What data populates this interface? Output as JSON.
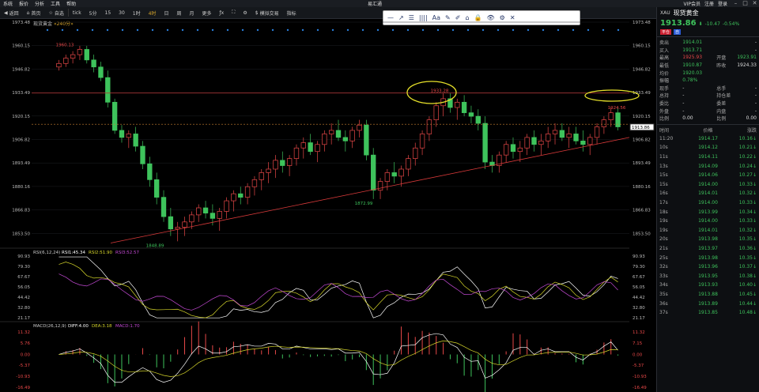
{
  "menubar": {
    "items": [
      "系统",
      "报价",
      "分析",
      "工具",
      "帮助"
    ],
    "app_title": "易汇通",
    "right_items": [
      "VIP会员",
      "注册",
      "登录"
    ]
  },
  "toolbar": {
    "buttons": [
      "返回",
      "首页",
      "自选",
      "tick",
      "5分",
      "15",
      "30",
      "1时",
      "4时",
      "日",
      "周",
      "月",
      "更多",
      "模拟交易",
      "指标"
    ]
  },
  "drawing_toolbar": {
    "tools": [
      "—",
      "↗",
      "☰",
      "||||",
      "Aa",
      "✎",
      "✐",
      "⌂",
      "🔒",
      "👁",
      "⚙",
      "✕"
    ]
  },
  "chart": {
    "title": "现货黄金",
    "period": "240分",
    "left_axis": [
      "1973.48",
      "1960.15",
      "1946.82",
      "1933.49",
      "1920.15",
      "1906.82",
      "1893.49",
      "1880.16",
      "1866.83",
      "1853.50"
    ],
    "right_axis": [
      "1973.48",
      "1960.15",
      "1946.82",
      "1933.49",
      "1920.15",
      "1906.82",
      "1893.49",
      "1880.16",
      "1866.83",
      "1853.50"
    ],
    "current_price_tag": "1913.86",
    "annotations": [
      "1960.13",
      "1933.28",
      "1924.56",
      "1872.99",
      "1848.89"
    ],
    "candles": [
      [
        1948,
        1952,
        1946,
        1950
      ],
      [
        1950,
        1955,
        1948,
        1953
      ],
      [
        1953,
        1957,
        1950,
        1955
      ],
      [
        1955,
        1960,
        1952,
        1958
      ],
      [
        1958,
        1960,
        1950,
        1952
      ],
      [
        1952,
        1955,
        1945,
        1948
      ],
      [
        1948,
        1951,
        1940,
        1942
      ],
      [
        1942,
        1946,
        1925,
        1928
      ],
      [
        1928,
        1930,
        1910,
        1912
      ],
      [
        1912,
        1915,
        1905,
        1908
      ],
      [
        1908,
        1912,
        1902,
        1910
      ],
      [
        1910,
        1914,
        1900,
        1903
      ],
      [
        1903,
        1906,
        1890,
        1893
      ],
      [
        1893,
        1897,
        1880,
        1884
      ],
      [
        1884,
        1888,
        1870,
        1874
      ],
      [
        1874,
        1878,
        1860,
        1863
      ],
      [
        1863,
        1868,
        1852,
        1856
      ],
      [
        1856,
        1860,
        1849,
        1857
      ],
      [
        1857,
        1863,
        1852,
        1860
      ],
      [
        1860,
        1866,
        1856,
        1864
      ],
      [
        1864,
        1870,
        1860,
        1868
      ],
      [
        1868,
        1872,
        1862,
        1865
      ],
      [
        1865,
        1870,
        1858,
        1862
      ],
      [
        1862,
        1868,
        1855,
        1866
      ],
      [
        1866,
        1874,
        1862,
        1872
      ],
      [
        1872,
        1878,
        1866,
        1876
      ],
      [
        1876,
        1880,
        1870,
        1874
      ],
      [
        1874,
        1882,
        1870,
        1880
      ],
      [
        1880,
        1886,
        1875,
        1884
      ],
      [
        1884,
        1890,
        1878,
        1888
      ],
      [
        1888,
        1894,
        1882,
        1890
      ],
      [
        1890,
        1898,
        1885,
        1895
      ],
      [
        1895,
        1900,
        1888,
        1892
      ],
      [
        1892,
        1898,
        1886,
        1896
      ],
      [
        1896,
        1904,
        1892,
        1902
      ],
      [
        1902,
        1908,
        1896,
        1905
      ],
      [
        1905,
        1910,
        1898,
        1900
      ],
      [
        1900,
        1906,
        1894,
        1904
      ],
      [
        1904,
        1912,
        1900,
        1910
      ],
      [
        1910,
        1916,
        1904,
        1912
      ],
      [
        1912,
        1918,
        1906,
        1908
      ],
      [
        1908,
        1912,
        1900,
        1906
      ],
      [
        1906,
        1914,
        1902,
        1912
      ],
      [
        1912,
        1918,
        1908,
        1915
      ],
      [
        1915,
        1918,
        1895,
        1898
      ],
      [
        1898,
        1902,
        1873,
        1878
      ],
      [
        1878,
        1885,
        1873,
        1883
      ],
      [
        1883,
        1890,
        1878,
        1888
      ],
      [
        1888,
        1894,
        1882,
        1886
      ],
      [
        1886,
        1892,
        1880,
        1890
      ],
      [
        1890,
        1898,
        1886,
        1896
      ],
      [
        1896,
        1905,
        1892,
        1902
      ],
      [
        1902,
        1912,
        1898,
        1910
      ],
      [
        1910,
        1920,
        1906,
        1918
      ],
      [
        1918,
        1928,
        1914,
        1926
      ],
      [
        1926,
        1933,
        1920,
        1930
      ],
      [
        1930,
        1933,
        1922,
        1925
      ],
      [
        1925,
        1930,
        1918,
        1928
      ],
      [
        1928,
        1932,
        1920,
        1922
      ],
      [
        1922,
        1926,
        1916,
        1920
      ],
      [
        1920,
        1924,
        1912,
        1916
      ],
      [
        1916,
        1920,
        1890,
        1894
      ],
      [
        1894,
        1898,
        1888,
        1892
      ],
      [
        1892,
        1900,
        1888,
        1898
      ],
      [
        1898,
        1906,
        1894,
        1904
      ],
      [
        1904,
        1908,
        1896,
        1900
      ],
      [
        1900,
        1906,
        1894,
        1902
      ],
      [
        1902,
        1910,
        1898,
        1908
      ],
      [
        1908,
        1912,
        1900,
        1904
      ],
      [
        1904,
        1910,
        1898,
        1906
      ],
      [
        1906,
        1914,
        1902,
        1910
      ],
      [
        1910,
        1916,
        1904,
        1912
      ],
      [
        1912,
        1916,
        1906,
        1908
      ],
      [
        1908,
        1914,
        1902,
        1910
      ],
      [
        1910,
        1914,
        1904,
        1906
      ],
      [
        1906,
        1912,
        1900,
        1904
      ],
      [
        1904,
        1910,
        1898,
        1908
      ],
      [
        1908,
        1916,
        1904,
        1914
      ],
      [
        1914,
        1920,
        1910,
        1918
      ],
      [
        1918,
        1925,
        1914,
        1922
      ],
      [
        1922,
        1925,
        1912,
        1914
      ]
    ],
    "support_line": [
      [
        1848,
        5
      ],
      [
        1906,
        81
      ]
    ],
    "resistance_line": 1933.2,
    "dashed_line": 1915.5
  },
  "rsi": {
    "label": "RSI(6,12,24)",
    "rsi1": "RSI1:45.34",
    "rsi2": "RSI2:51.90",
    "rsi3": "RSI3:52.57",
    "axis": [
      "90.93",
      "79.30",
      "67.67",
      "56.05",
      "44.42",
      "32.80",
      "21.17"
    ]
  },
  "macd": {
    "label": "MACD(26,12,9)",
    "diff": "DIFF:4.00",
    "dea": "DEA:3.18",
    "macd": "MACD:1.70",
    "axis": [
      "11.32",
      "5.76",
      "0.00",
      "-5.37",
      "-10.93",
      "-16.49"
    ],
    "right_axis": [
      "11.32",
      "7.15",
      "0.00",
      "-5.37",
      "-10.93",
      "-16.49"
    ]
  },
  "quote": {
    "code": "XAU",
    "name": "现货黄金",
    "price": "1913.86",
    "change": "-10.47",
    "change_pct": "-0.54%",
    "badges": [
      "平仓",
      "自"
    ],
    "rows": [
      {
        "k": "卖出",
        "v": "1914.01",
        "k2": "",
        "v2": "-"
      },
      {
        "k": "买入",
        "v": "1913.71",
        "k2": "",
        "v2": "-"
      },
      {
        "k": "最高",
        "v": "1925.93",
        "k2": "开盘",
        "v2": "1923.91"
      },
      {
        "k": "最低",
        "v": "1910.87",
        "k2": "昨收",
        "v2": "1924.33"
      },
      {
        "k": "均价",
        "v": "1920.03",
        "k2": "",
        "v2": ""
      },
      {
        "k": "振幅",
        "v": "0.78%",
        "k2": "",
        "v2": ""
      },
      {
        "k": "现手",
        "v": "-",
        "k2": "总手",
        "v2": "-"
      },
      {
        "k": "总持",
        "v": "-",
        "k2": "持仓差",
        "v2": "-"
      },
      {
        "k": "委比",
        "v": "-",
        "k2": "委差",
        "v2": "-"
      },
      {
        "k": "外盘",
        "v": "-",
        "k2": "内盘",
        "v2": "-"
      },
      {
        "k": "比例",
        "v": "0.00",
        "k2": "比例",
        "v2": "0.00"
      }
    ],
    "trades_header": [
      "时间",
      "价格",
      "涨跌"
    ],
    "trades": [
      [
        "11:20",
        "1914.17",
        "10.16↓"
      ],
      [
        "10s",
        "1914.12",
        "10.21↓"
      ],
      [
        "11s",
        "1914.11",
        "10.22↓"
      ],
      [
        "13s",
        "1914.09",
        "10.24↓"
      ],
      [
        "15s",
        "1914.06",
        "10.27↓"
      ],
      [
        "15s",
        "1914.00",
        "10.33↓"
      ],
      [
        "16s",
        "1914.01",
        "10.32↓"
      ],
      [
        "17s",
        "1914.00",
        "10.33↓"
      ],
      [
        "18s",
        "1913.99",
        "10.34↓"
      ],
      [
        "19s",
        "1914.00",
        "10.33↓"
      ],
      [
        "19s",
        "1914.01",
        "10.32↓"
      ],
      [
        "20s",
        "1913.98",
        "10.35↓"
      ],
      [
        "21s",
        "1913.97",
        "10.36↓"
      ],
      [
        "25s",
        "1913.98",
        "10.35↓"
      ],
      [
        "32s",
        "1913.96",
        "10.37↓"
      ],
      [
        "33s",
        "1913.95",
        "10.38↓"
      ],
      [
        "34s",
        "1913.93",
        "10.40↓"
      ],
      [
        "35s",
        "1913.88",
        "10.45↓"
      ],
      [
        "36s",
        "1913.89",
        "10.44↓"
      ],
      [
        "37s",
        "1913.85",
        "10.48↓"
      ]
    ]
  }
}
